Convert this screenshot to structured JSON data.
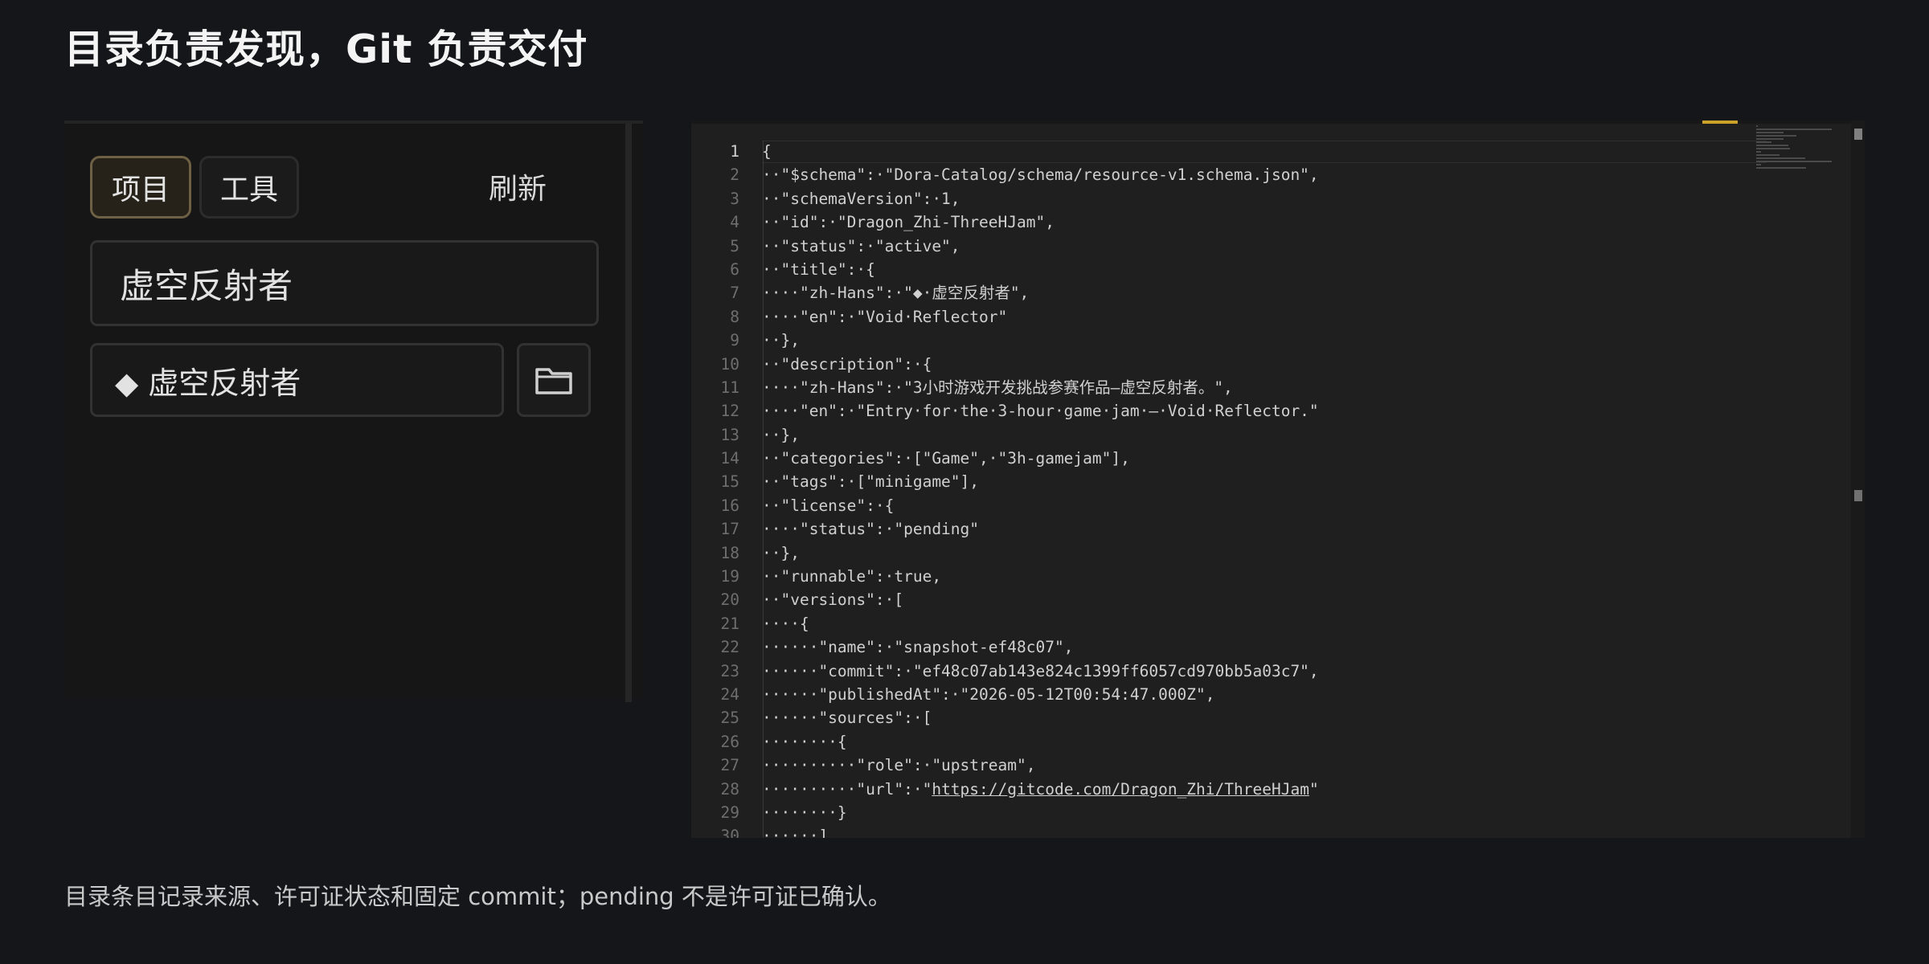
{
  "slide": {
    "title": "目录负责发现，Git 负责交付",
    "caption": "目录条目记录来源、许可证状态和固定 commit；pending 不是许可证已确认。"
  },
  "panel": {
    "tabs": [
      {
        "label": "项目",
        "active": true
      },
      {
        "label": "工具",
        "active": false
      }
    ],
    "refresh_label": "刷新",
    "name_value": "虚空反射者",
    "display_value": "◆ 虚空反射者",
    "folder_icon": "folder-icon"
  },
  "editor": {
    "url_text": "https://gitcode.com/Dragon_Zhi/ThreeHJam",
    "lines": [
      "{",
      "··\"$schema\":·\"Dora-Catalog/schema/resource-v1.schema.json\",",
      "··\"schemaVersion\":·1,",
      "··\"id\":·\"Dragon_Zhi-ThreeHJam\",",
      "··\"status\":·\"active\",",
      "··\"title\":·{",
      "····\"zh-Hans\":·\"◆·虚空反射者\",",
      "····\"en\":·\"Void·Reflector\"",
      "··},",
      "··\"description\":·{",
      "····\"zh-Hans\":·\"3小时游戏开发挑战参赛作品—虚空反射者。\",",
      "····\"en\":·\"Entry·for·the·3-hour·game·jam·—·Void·Reflector.\"",
      "··},",
      "··\"categories\":·[\"Game\",·\"3h-gamejam\"],",
      "··\"tags\":·[\"minigame\"],",
      "··\"license\":·{",
      "····\"status\":·\"pending\"",
      "··},",
      "··\"runnable\":·true,",
      "··\"versions\":·[",
      "····{",
      "······\"name\":·\"snapshot-ef48c07\",",
      "······\"commit\":·\"ef48c07ab143e824c1399ff6057cd970bb5a03c7\",",
      "······\"publishedAt\":·\"2026-05-12T00:54:47.000Z\",",
      "······\"sources\":·[",
      "········{",
      "··········\"role\":·\"upstream\",",
      "··········\"url\":·\"https://gitcode.com/Dragon_Zhi/ThreeHJam\"",
      "········}",
      "······]"
    ]
  },
  "colors": {
    "background": "#14161a",
    "accent": "#c9a227",
    "active_tab_border": "#6e6044"
  }
}
